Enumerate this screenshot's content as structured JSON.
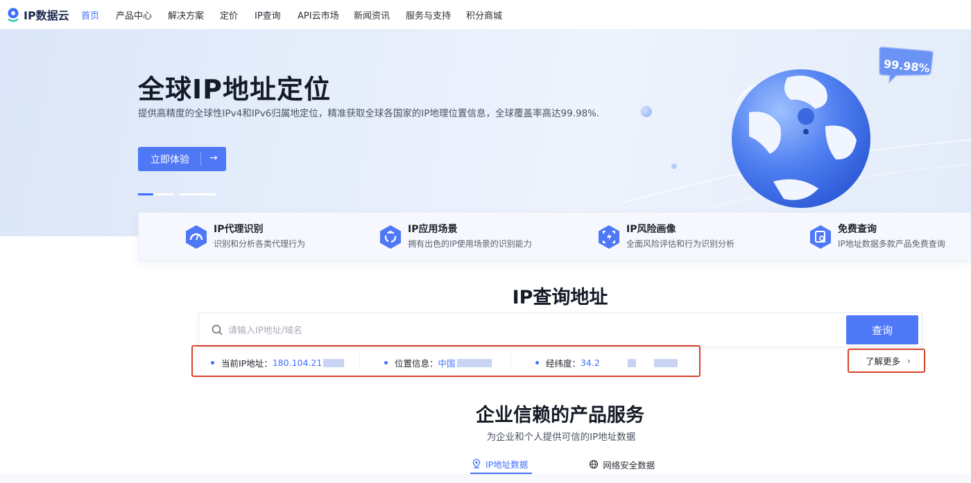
{
  "nav": {
    "logo_text": "IP数据云",
    "items": [
      "首页",
      "产品中心",
      "解决方案",
      "定价",
      "IP查询",
      "API云市场",
      "新闻资讯",
      "服务与支持",
      "积分商城"
    ],
    "active_index": 0
  },
  "hero": {
    "title": "全球IP地址定位",
    "subtitle": "提供高精度的全球性IPv4和IPv6归属地定位，精准获取全球各国家的IP地理位置信息，全球覆盖率高达99.98%.",
    "cta_label": "立即体验",
    "badge_text": "99.98%",
    "carousel_count": 3,
    "carousel_active": 0
  },
  "features": [
    {
      "title": "IP代理识别",
      "desc": "识别和分析各类代理行为",
      "icon": "speedometer-icon"
    },
    {
      "title": "IP应用场景",
      "desc": "拥有出色的IP使用场景的识别能力",
      "icon": "cycle-icon"
    },
    {
      "title": "IP风险画像",
      "desc": "全面风险评估和行为识别分析",
      "icon": "risk-scan-icon"
    },
    {
      "title": "免费查询",
      "desc": "IP地址数据多款产品免费查询",
      "icon": "search-doc-icon"
    }
  ],
  "ip_query": {
    "title": "IP查询地址",
    "placeholder": "请输入IP地址/域名",
    "button_label": "查询",
    "current_ip_label": "当前IP地址：",
    "current_ip_value": "180.104.21",
    "location_label": "位置信息：",
    "location_value": "中国",
    "latlng_label": "经纬度：",
    "latlng_value": "34.2",
    "more_label": "了解更多",
    "accent": "#3d6fff",
    "highlight_border": "#d9412b"
  },
  "products": {
    "title": "企业信赖的产品服务",
    "subtitle": "为企业和个人提供可信的IP地址数据",
    "tabs": [
      "IP地址数据",
      "网络安全数据"
    ],
    "active_tab": 0
  }
}
